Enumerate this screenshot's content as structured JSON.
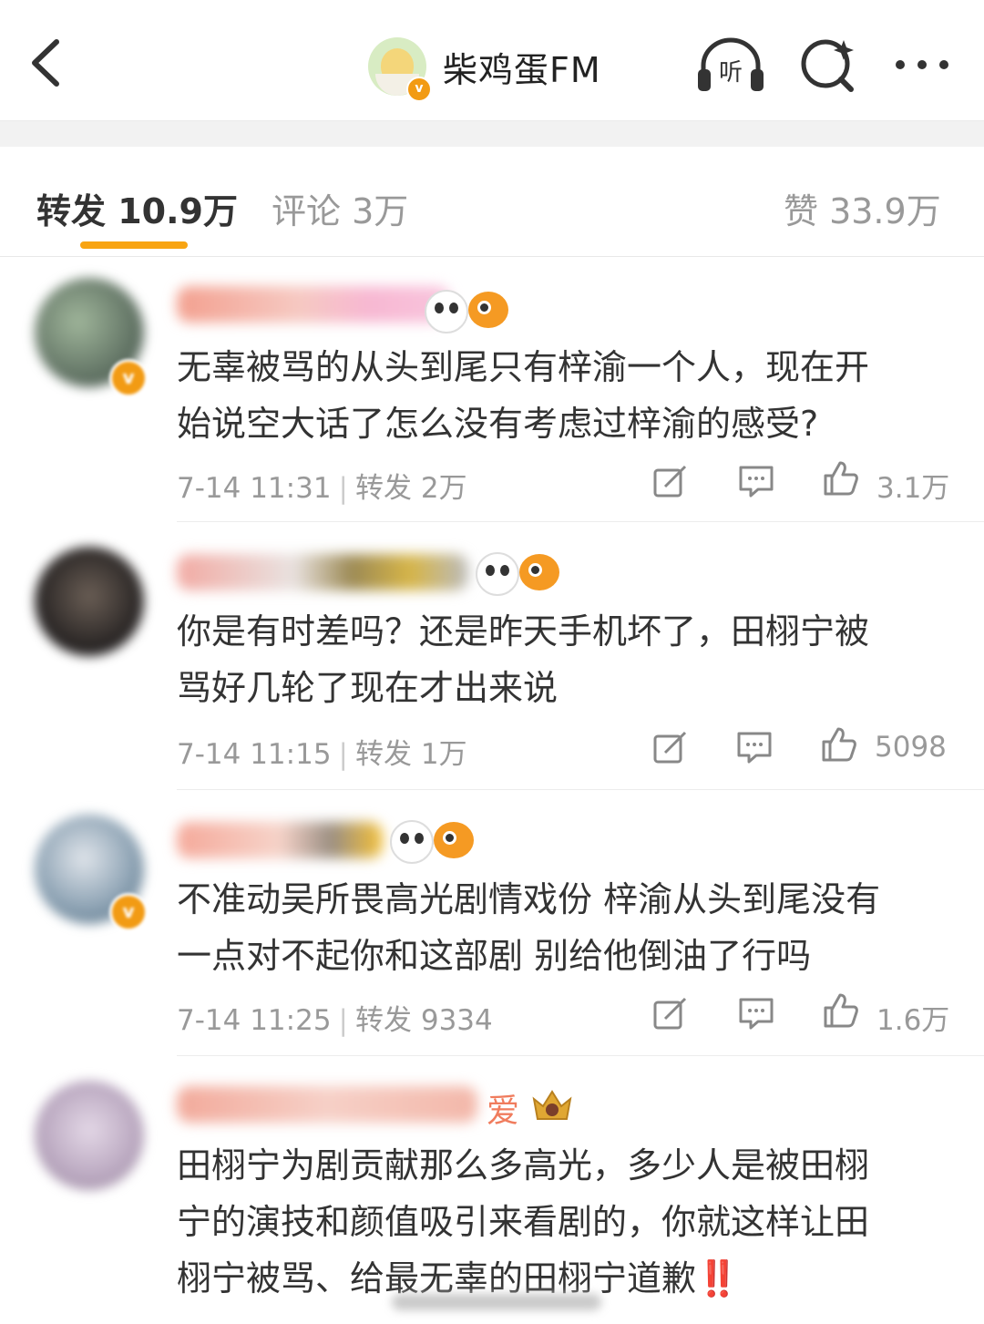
{
  "header": {
    "account_name": "柴鸡蛋FM",
    "verified_badge": "v",
    "listen_label": "听"
  },
  "tabs": [
    {
      "label": "转发 10.9万"
    },
    {
      "label": "评论 3万"
    },
    {
      "label": "赞 33.9万"
    }
  ],
  "comments": [
    {
      "text_line1": "无辜被骂的从头到尾只有梓渝一个人，现在开",
      "text_line2": "始说空大话了怎么没有考虑过梓渝的感受?",
      "time": "7-14 11:31",
      "repost": "转发 2万",
      "likes": "3.1万"
    },
    {
      "text_line1": "你是有时差吗？还是昨天手机坏了，田栩宁被",
      "text_line2": "骂好几轮了现在才出来说",
      "time": "7-14 11:15",
      "repost": "转发 1万",
      "likes": "5098"
    },
    {
      "text_line1": "不准动吴所畏高光剧情戏份 梓渝从头到尾没有",
      "text_line2": "一点对不起你和这部剧 别给他倒油了行吗",
      "time": "7-14 11:25",
      "repost": "转发 9334",
      "likes": "1.6万"
    },
    {
      "text_line1": "田栩宁为剧贡献那么多高光，多少人是被田栩",
      "text_line2": "宁的演技和颜值吸引来看剧的，你就这样让田",
      "text_line3": "栩宁被骂、给最无辜的田栩宁道歉",
      "emoji": "‼️",
      "username_fragment": "爱"
    }
  ],
  "colors": {
    "accent": "#f8a412",
    "verified": "#f29b14",
    "text": "#333333",
    "muted": "#999999"
  }
}
